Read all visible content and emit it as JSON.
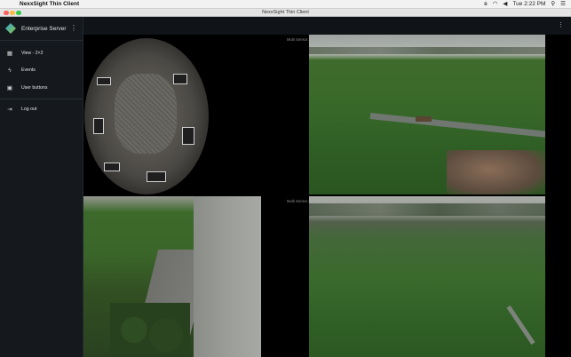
{
  "menubar": {
    "app_name": "NexxSight Thin Client",
    "clock": "Tue 2:22 PM"
  },
  "window": {
    "title": "NexxSight Thin Client"
  },
  "sidebar": {
    "server_name": "Enterprise Server",
    "items": [
      {
        "label": "View - 2×2",
        "icon": "grid-icon"
      },
      {
        "label": "Events",
        "icon": "lightning-icon"
      },
      {
        "label": "User buttons",
        "icon": "trash-icon"
      },
      {
        "label": "Log out",
        "icon": "logout-icon"
      }
    ]
  },
  "cameras": [
    {
      "label": ""
    },
    {
      "label": "Multi Sensor 2MLA (Kid1.1)"
    },
    {
      "label": ""
    },
    {
      "label": "Multi Sensor 2MLA (Kid1.1)"
    }
  ],
  "colors": {
    "sidebar_bg": "#15191d",
    "topstrip_bg": "#101418",
    "accent_logo_start": "#2ea3d8",
    "accent_logo_end": "#8dc63f"
  }
}
